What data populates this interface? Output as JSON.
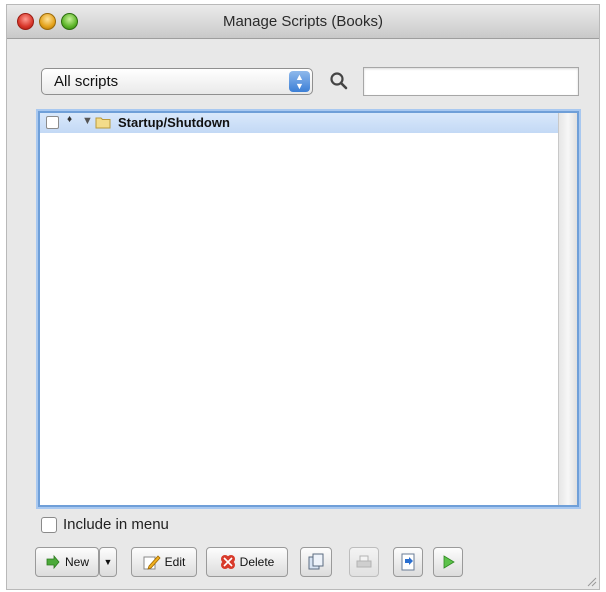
{
  "window": {
    "title": "Manage Scripts (Books)"
  },
  "toolbar": {
    "filter_popup": {
      "selected": "All scripts"
    },
    "search": {
      "value": "",
      "placeholder": ""
    }
  },
  "script_list": {
    "rows": [
      {
        "label": "Startup/Shutdown",
        "type": "folder",
        "expanded": true,
        "checked": false,
        "selected": true
      }
    ]
  },
  "include_in_menu": {
    "label": "Include in menu",
    "checked": false
  },
  "buttons": {
    "new_label": "New",
    "edit_label": "Edit",
    "delete_label": "Delete"
  },
  "colors": {
    "selection": "#c3d9f5",
    "focus_ring": "#6f9fd8",
    "window_bg": "#e8e8e8"
  },
  "icons": [
    "close-traffic",
    "minimize-traffic",
    "zoom-traffic",
    "search-icon",
    "folder-icon",
    "new-icon",
    "edit-icon",
    "delete-icon",
    "duplicate-icon",
    "print-icon",
    "import-icon",
    "perform-icon"
  ]
}
